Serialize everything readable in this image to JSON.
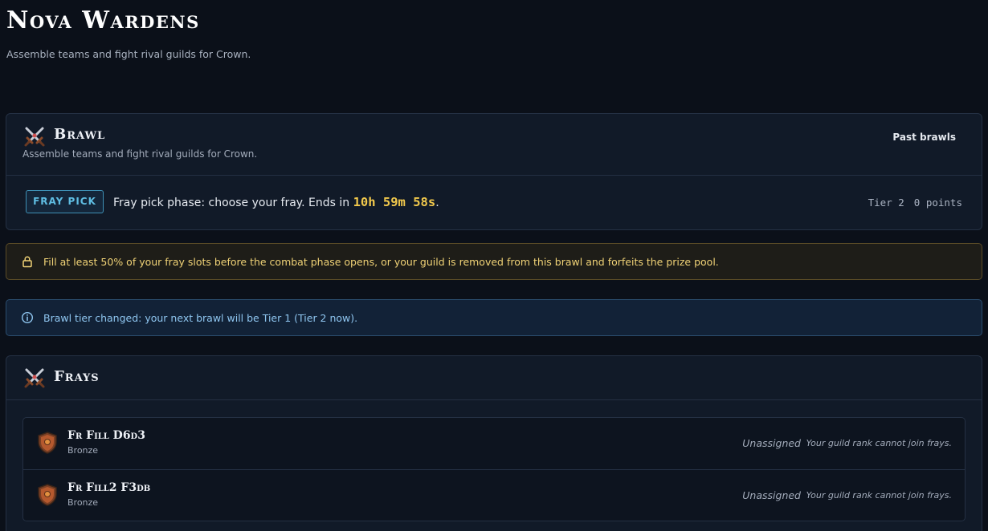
{
  "page": {
    "title": "Nova Wardens",
    "subtitle": "Assemble teams and fight rival guilds for Crown."
  },
  "brawl": {
    "icon": "crossed-swords-icon",
    "title": "Brawl",
    "subtitle": "Assemble teams and fight rival guilds for Crown.",
    "past_brawls_label": "Past brawls",
    "phase_badge": "FRAY PICK",
    "phase_text": "Fray pick phase: choose your fray. Ends in",
    "countdown": "10h 59m 58s",
    "phase_suffix": ".",
    "tier_label": "Tier 2",
    "points_label": "0 points"
  },
  "alerts": {
    "warning": {
      "icon": "lock-icon",
      "text": "Fill at least 50% of your fray slots before the combat phase opens, or your guild is removed from this brawl and forfeits the prize pool."
    },
    "info": {
      "icon": "info-icon",
      "text": "Brawl tier changed: your next brawl will be Tier 1 (Tier 2 now)."
    }
  },
  "frays": {
    "icon": "crossed-swords-icon",
    "title": "Frays",
    "items": [
      {
        "name": "Fr Fill D6d3",
        "tier": "Bronze",
        "status": "Unassigned",
        "note": "Your guild rank cannot join frays."
      },
      {
        "name": "Fr Fill2 F3db",
        "tier": "Bronze",
        "status": "Unassigned",
        "note": "Your guild rank cannot join frays."
      }
    ]
  },
  "colors": {
    "background": "#0b1019",
    "card": "#111a28",
    "accent_cyan": "#5fbde2",
    "countdown_gold": "#f2c94c",
    "warning_text": "#f0d276",
    "info_text": "#8fc6f0"
  }
}
